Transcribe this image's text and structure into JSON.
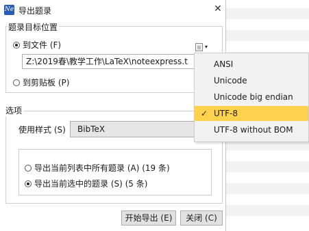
{
  "window": {
    "title": "导出题录",
    "app_icon": "Ne",
    "close_label": "✕"
  },
  "target_group": {
    "legend": "题录目标位置",
    "to_file_label": "到文件 (F)",
    "file_path": "Z:\\2019春\\教学工作\\LaTeX\\noteexpress.t",
    "to_clipboard_label": "到剪贴板 (P)",
    "selected": "to_file"
  },
  "encoding_menu": {
    "items": [
      "ANSI",
      "Unicode",
      "Unicode big endian",
      "UTF-8",
      "UTF-8 without BOM"
    ],
    "selected": "UTF-8",
    "check_mark": "✓",
    "caret": "▾"
  },
  "options_group": {
    "legend": "选项",
    "style_label": "使用样式 (S)",
    "style_value": "BibTeX",
    "export_all_label": "导出当前列表中所有题录 (A) (19 条)",
    "export_selected_label": "导出当前选中的题录 (S) (5 条)",
    "selected": "export_selected"
  },
  "buttons": {
    "export": "开始导出 (E)",
    "close": "关闭 (C)"
  },
  "colors": {
    "menu_highlight": "#ffd24d",
    "app_icon_bg": "#2b5bb3"
  }
}
